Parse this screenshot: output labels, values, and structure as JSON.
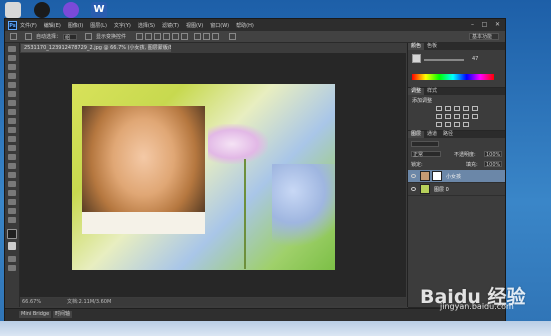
{
  "window": {
    "app_logo": "Ps",
    "menu": [
      "文件(F)",
      "编辑(E)",
      "图像(I)",
      "图层(L)",
      "文字(Y)",
      "选择(S)",
      "滤镜(T)",
      "视图(V)",
      "窗口(W)",
      "帮助(H)"
    ],
    "controls": [
      "–",
      "□",
      "✕"
    ]
  },
  "options_bar": {
    "auto_select_label": "自动选择：",
    "auto_select_value": "组",
    "show_transform_label": "显示变换控件",
    "workspace": "基本功能"
  },
  "document": {
    "tab_title": "2531170_123912478729_2.jpg @ 66.7% (小女孩, 图层蒙版/8)"
  },
  "status": {
    "zoom": "66.67%",
    "doc_info": "文档:2.11M/3.60M"
  },
  "bottom_tabs": [
    "Mini Bridge",
    "时间轴"
  ],
  "panels": {
    "color_tabs": [
      "颜色",
      "色板"
    ],
    "color_value": "47",
    "adjust_tabs": [
      "调整",
      "样式"
    ],
    "adjust_label": "添加调整",
    "layers_tabs": [
      "图层",
      "通道",
      "路径"
    ],
    "blend_mode": "正常",
    "opacity_label": "不透明度:",
    "opacity_value": "100%",
    "lock_label": "锁定:",
    "fill_label": "填充:",
    "fill_value": "100%",
    "layers": [
      {
        "name": "小女孩",
        "selected": true
      },
      {
        "name": "图层 0",
        "selected": false
      }
    ]
  },
  "watermark": {
    "brand": "Baidu 经验",
    "url": "jingyan.baidu.com"
  },
  "colors": {
    "ps_bg": "#3c3c3c",
    "canvas_bg": "#272727",
    "selected_layer": "#6b87a8"
  }
}
